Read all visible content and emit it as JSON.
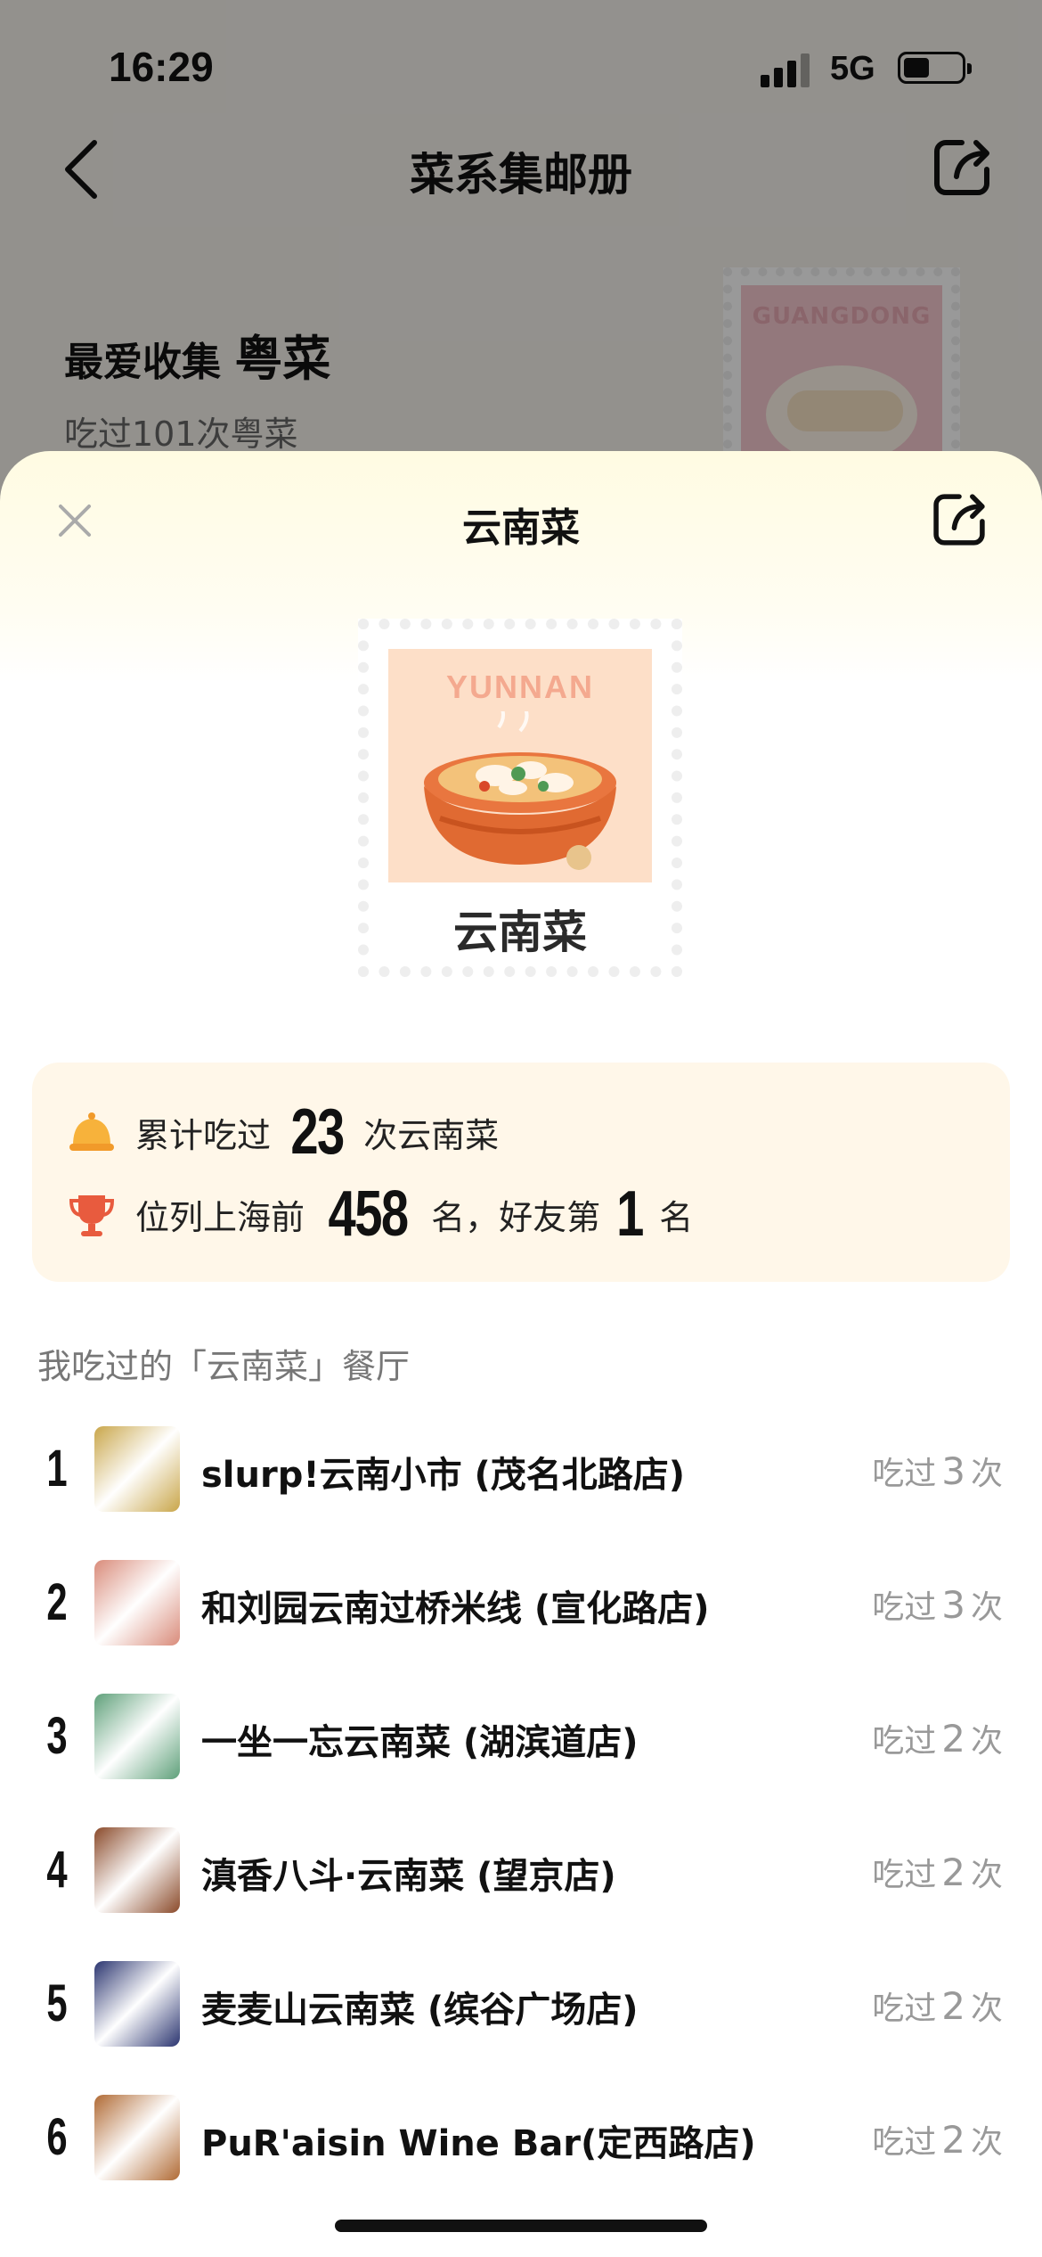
{
  "status_bar": {
    "time": "16:29",
    "network": "5G"
  },
  "background_page": {
    "title": "菜系集邮册",
    "favorite_prefix": "最爱收集",
    "favorite_cuisine": "粤菜",
    "favorite_sub": "吃过101次粤菜",
    "stamp_caption": "GUANGDONG"
  },
  "sheet": {
    "title": "云南菜",
    "stamp": {
      "caption": "YUNNAN",
      "name": "云南菜"
    },
    "stats": {
      "line1_prefix": "累计吃过",
      "line1_count": "23",
      "line1_suffix": "次云南菜",
      "line2_prefix": "位列上海前",
      "line2_rank": "458",
      "line2_mid": "名，好友第",
      "line2_friend_rank": "1",
      "line2_suffix": "名"
    },
    "section_label": "我吃过的「云南菜」餐厅",
    "visit_prefix": "吃过",
    "visit_suffix": "次",
    "restaurants": [
      {
        "rank": "1",
        "name": "slurp!云南小市 (茂名北路店)",
        "visits": "3",
        "thumb_color": "#c9a64a"
      },
      {
        "rank": "2",
        "name": "和刘园云南过桥米线 (宣化路店)",
        "visits": "3",
        "thumb_color": "#d98b7a"
      },
      {
        "rank": "3",
        "name": "一坐一忘云南菜 (湖滨道店)",
        "visits": "2",
        "thumb_color": "#5fa07a"
      },
      {
        "rank": "4",
        "name": "滇香八斗·云南菜 (望京店)",
        "visits": "2",
        "thumb_color": "#8a4a2a"
      },
      {
        "rank": "5",
        "name": "麦麦山云南菜 (缤谷广场店)",
        "visits": "2",
        "thumb_color": "#2b3570"
      },
      {
        "rank": "6",
        "name": "PuR'aisin Wine Bar(定西路店)",
        "visits": "2",
        "thumb_color": "#b06a34"
      }
    ]
  }
}
